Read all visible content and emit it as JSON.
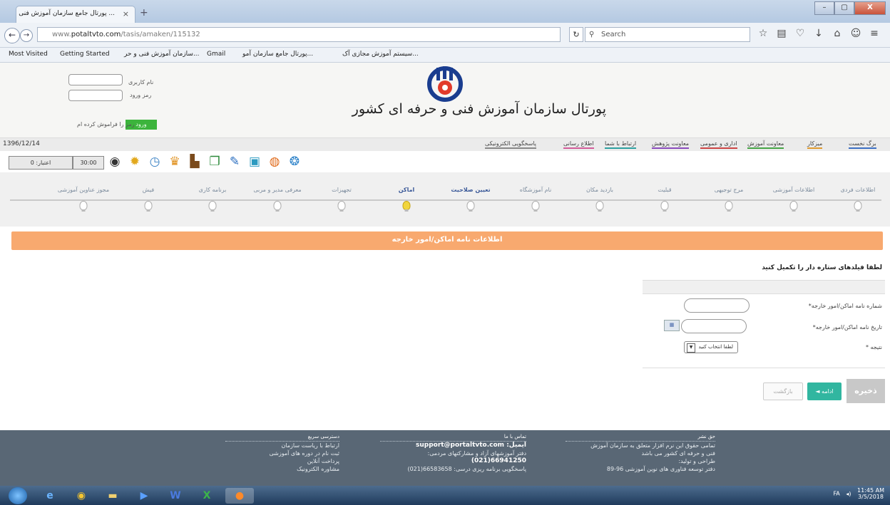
{
  "browser": {
    "tab_title": "... پورتال جامع سازمان آموزش فنی",
    "tab_close": "×",
    "new_tab": "+",
    "url_prefix": "www.",
    "url_domain": "potaltvto.com",
    "url_path": "/tasis/amaken/115132",
    "search_placeholder": "Search",
    "bookmarks": [
      "Most Visited",
      "Getting Started",
      "...سازمان آموزش فنی و حر",
      "Gmail",
      "...پورتال جامع سازمان آمو",
      "...سیستم آموزش مجازی آک"
    ],
    "window_buttons": [
      "–",
      "▢",
      "X"
    ]
  },
  "header": {
    "username_label": "نام کاربری",
    "password_label": "رمز ورود",
    "login_button": "ورود",
    "forgot_link": "رمز را فراموش کرده ام",
    "site_title": "پورتال سازمان آموزش فنی و حرفه ای کشور",
    "date": "1396/12/14"
  },
  "menu": [
    "برگ نخست",
    "میزکار",
    "معاونت آموزش",
    "اداری و عمومی",
    "معاونت پژوهش",
    "ارتباط با شما",
    "اطلاع رسانی",
    "پاسخگویی الکترونیکی"
  ],
  "menu_colors": [
    "#3c6fc4",
    "#e09a2c",
    "#46a546",
    "#c44",
    "#8a4bbd",
    "#2ca0a0",
    "#d35c9a",
    "#888"
  ],
  "iconbar": {
    "credit": "اعتبار: 0",
    "timer": "30:00"
  },
  "steps": [
    "اطلاعات فردی",
    "اطلاعات آموزشی",
    "مرج توجیهی",
    "قبلیت",
    "بازدید مکان",
    "نام آموزشگاه",
    "تعیین صلاحیت",
    "اماکن",
    "تجهیزات",
    "معرفی مدیر و مربی",
    "برنامه کاری",
    "فیش",
    "مجوز عناوین آموزشی"
  ],
  "active_step": 7,
  "visited_steps": [
    6,
    7
  ],
  "banner": "اطلاعات نامه اماکن/امور خارجه",
  "hint": "لطفا فیلدهای ستاره دار را تکمیل کنید",
  "form": {
    "field1_label": "شماره نامه اماکن/امور خارجه*",
    "field2_label": "تاریخ نامه اماکن/امور خارجه*",
    "field3_label": "نتیجه *",
    "select_value": "لطفا انتخاب کنید"
  },
  "buttons": {
    "save": "ذخیره",
    "next": "ادامه ◄",
    "back": "بازگشت"
  },
  "footer": {
    "col1_title": "حق نشر",
    "col1_lines": [
      "تمامی حقوق این نرم افزار متعلق به سازمان آموزش",
      "فنی و حرفه ای کشور می باشد",
      "طراحی و تولید:",
      "دفتر توسعه فناوری های نوین آموزشی 96-89"
    ],
    "col2_title": "تماس با ما",
    "col2_email": "ایمیل: support@portaltvto.com",
    "col2_lines": [
      "دفتر آموزشهای آزاد و مشارکتهای مردمی:",
      "66941250(021)",
      "پاسخگویی برنامه ریزی درسی: 66583658(021)"
    ],
    "col3_title": "دسترسی سریع",
    "col3_lines": [
      "ارتباط با ریاست سازمان",
      "ثبت نام در دوره های آموزشی",
      "پرداخت آنلاین",
      "مشاوره الکترونیک"
    ]
  },
  "taskbar": {
    "lang": "FA",
    "time": "11:45 AM",
    "date": "3/5/2018"
  }
}
